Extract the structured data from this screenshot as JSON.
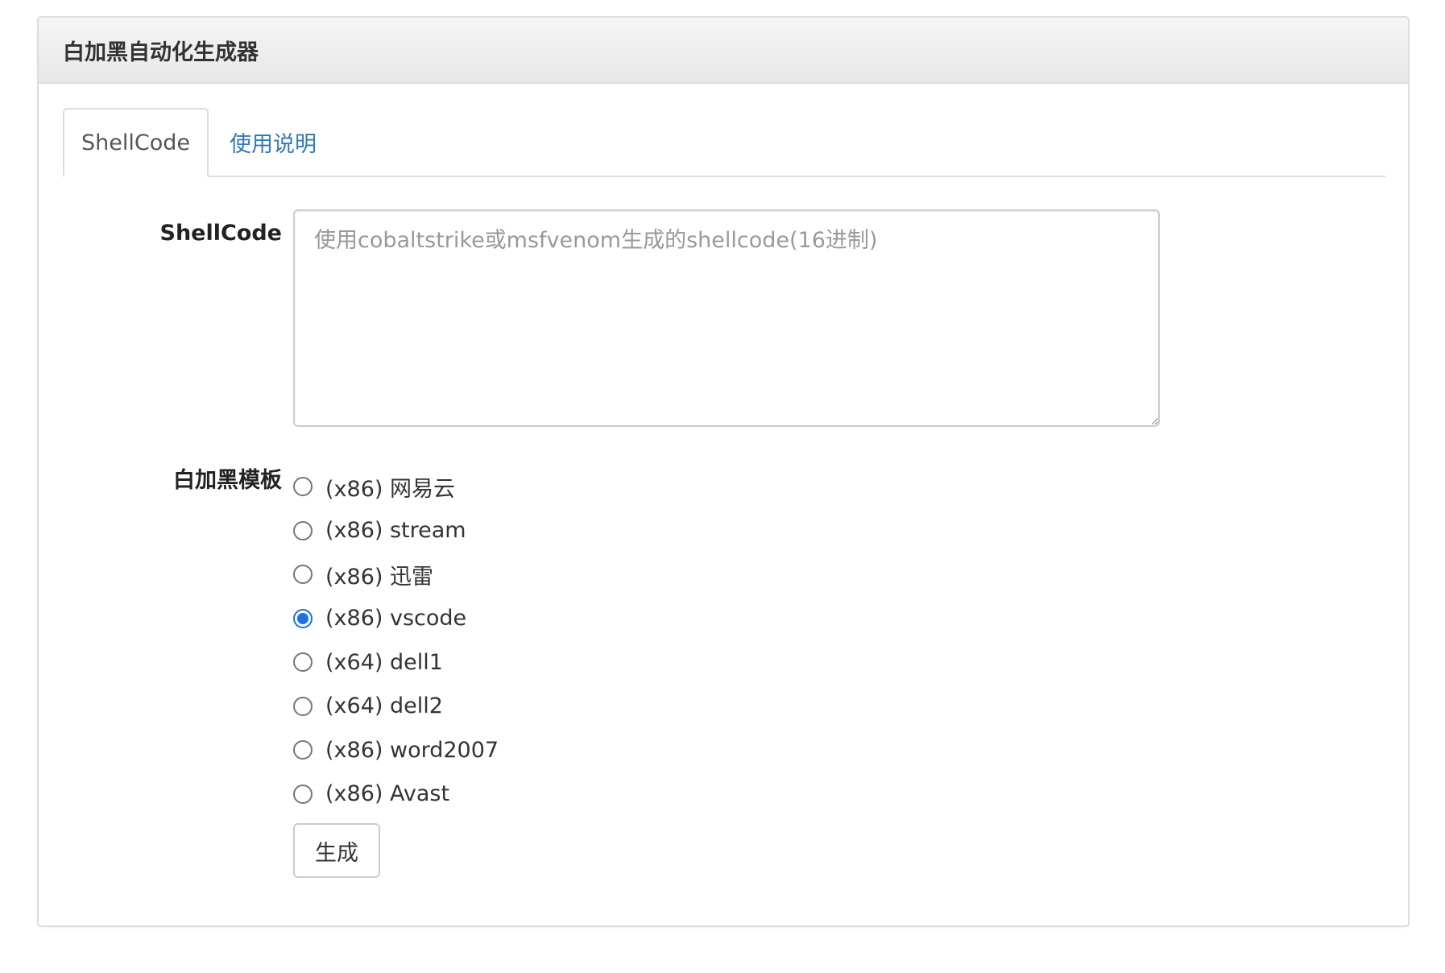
{
  "panel": {
    "title": "白加黑自动化生成器"
  },
  "tabs": [
    {
      "label": "ShellCode",
      "active": true
    },
    {
      "label": "使用说明",
      "active": false
    }
  ],
  "form": {
    "shellcode_label": "ShellCode",
    "shellcode_value": "",
    "shellcode_placeholder": "使用cobaltstrike或msfvenom生成的shellcode(16进制)",
    "template_label": "白加黑模板",
    "templates": [
      {
        "label": "(x86) 网易云",
        "checked": false
      },
      {
        "label": "(x86) stream",
        "checked": false
      },
      {
        "label": "(x86) 迅雷",
        "checked": false
      },
      {
        "label": "(x86) vscode",
        "checked": true
      },
      {
        "label": "(x64) dell1",
        "checked": false
      },
      {
        "label": "(x64) dell2",
        "checked": false
      },
      {
        "label": "(x86) word2007",
        "checked": false
      },
      {
        "label": "(x86) Avast",
        "checked": false
      }
    ],
    "generate_button": "生成"
  },
  "colors": {
    "accent": "#1a73e8",
    "link": "#337ab7",
    "border": "#dddddd"
  }
}
